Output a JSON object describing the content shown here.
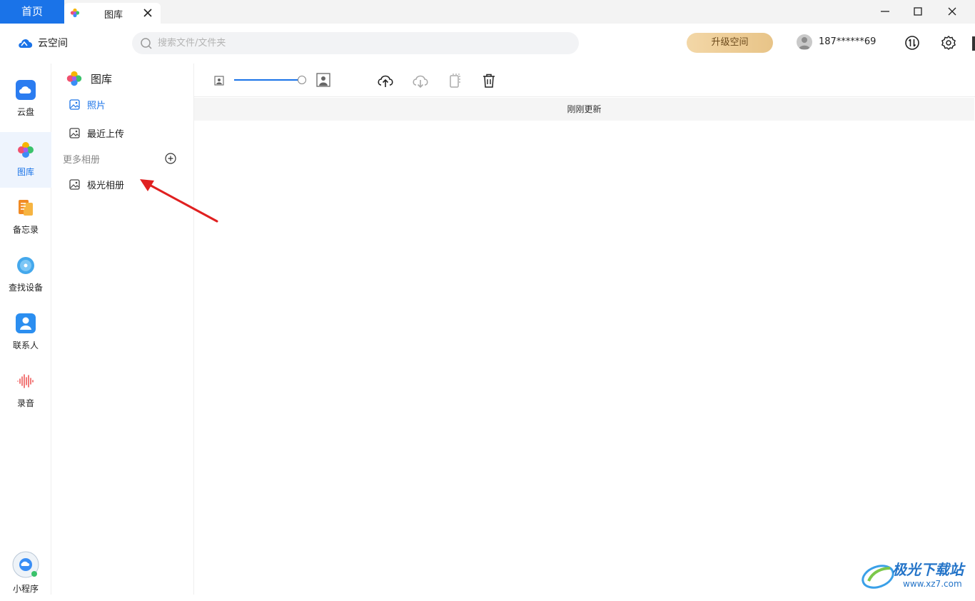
{
  "titlebar": {
    "home_tab": "首页",
    "doc_tab": "图库"
  },
  "header": {
    "brand": "云空间",
    "search_placeholder": "搜索文件/文件夹",
    "upgrade_label": "升级空间",
    "phone": "187******69"
  },
  "rail": {
    "items": [
      {
        "label": "云盘",
        "icon": "cloud-drive-icon"
      },
      {
        "label": "图库",
        "icon": "gallery-icon"
      },
      {
        "label": "备忘录",
        "icon": "notes-icon"
      },
      {
        "label": "查找设备",
        "icon": "find-device-icon"
      },
      {
        "label": "联系人",
        "icon": "contacts-icon"
      },
      {
        "label": "录音",
        "icon": "recording-icon"
      }
    ],
    "mini_program": "小程序"
  },
  "albums": {
    "title": "图库",
    "items": [
      {
        "label": "照片"
      },
      {
        "label": "最近上传"
      }
    ],
    "section_label": "更多相册",
    "more": [
      {
        "label": "极光相册"
      }
    ]
  },
  "main": {
    "status": "刚刚更新"
  },
  "watermark": {
    "title": "极光下载站",
    "url": "www.xz7.com"
  },
  "colors": {
    "accent": "#1a73e8",
    "upgrade_bg": "#ebcb94",
    "arrow": "#e02020"
  }
}
